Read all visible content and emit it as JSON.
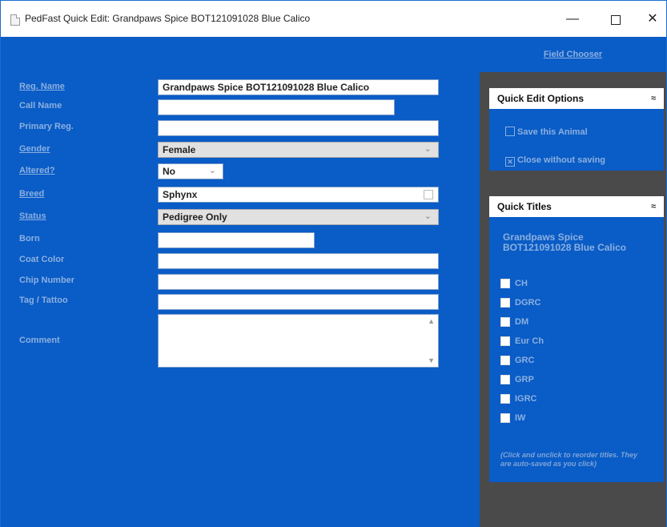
{
  "window": {
    "title": "PedFast Quick Edit: Grandpaws Spice BOT121091028 Blue Calico",
    "minimize_glyph": "—",
    "close_glyph": "✕"
  },
  "form": {
    "labels": {
      "reg_name": "Reg. Name",
      "call_name": "Call Name",
      "primary_reg": "Primary Reg.",
      "gender": "Gender",
      "altered": "Altered?",
      "breed": "Breed",
      "status": "Status",
      "born": "Born",
      "coat_color": "Coat Color",
      "chip_number": "Chip Number",
      "tag_tattoo": "Tag / Tattoo",
      "comment": "Comment"
    },
    "values": {
      "reg_name": "Grandpaws Spice BOT121091028 Blue Calico",
      "call_name": "",
      "primary_reg": "",
      "gender": "Female",
      "altered": "No",
      "breed": "Sphynx",
      "status": "Pedigree Only",
      "born": "",
      "coat_color": "",
      "chip_number": "",
      "tag_tattoo": "",
      "comment": ""
    },
    "chevron_glyph": "⌄"
  },
  "sidebar": {
    "field_chooser": "Field Chooser",
    "quick_edit_options": {
      "title": "Quick Edit Options",
      "save": "Save this Animal",
      "close": "Close without saving"
    },
    "quick_titles": {
      "title": "Quick Titles",
      "animal_name": "Grandpaws Spice BOT121091028 Blue Calico",
      "titles": [
        "CH",
        "DGRC",
        "DM",
        "Eur Ch",
        "GRC",
        "GRP",
        "IGRC",
        "IW"
      ],
      "hint": "(Click and unclick to reorder titles. They are auto-saved as you click)"
    },
    "collapse_glyph": "≈"
  }
}
